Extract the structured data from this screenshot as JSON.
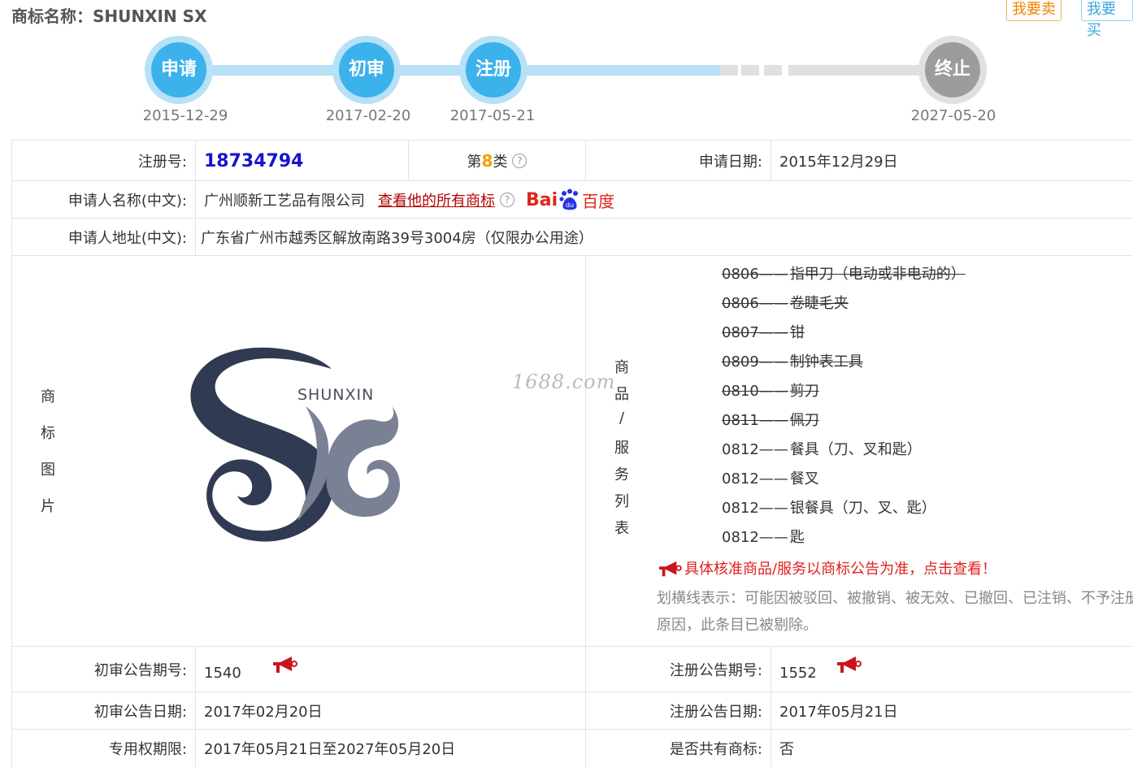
{
  "header": {
    "title": "商标名称：SHUNXIN SX",
    "btn_sell": "我要卖",
    "btn_buy": "我要买"
  },
  "timeline": [
    {
      "label": "申请",
      "date": "2015-12-29",
      "state": "done"
    },
    {
      "label": "初审",
      "date": "2017-02-20",
      "state": "done"
    },
    {
      "label": "注册",
      "date": "2017-05-21",
      "state": "done"
    },
    {
      "label": "终止",
      "date": "2027-05-20",
      "state": "future"
    }
  ],
  "info": {
    "reg_no_label": "注册号:",
    "reg_no": "18734794",
    "class_prefix": "第",
    "class_num": "8",
    "class_suffix": "类",
    "apply_date_label": "申请日期:",
    "apply_date": "2015年12月29日",
    "applicant_label": "申请人名称(中文):",
    "applicant": "广州顺新工艺品有限公司",
    "view_all_link": "查看他的所有商标",
    "baidu_bai": "Bai",
    "baidu_du": "du",
    "baidu_cn": "百度",
    "address_label": "申请人地址(中文):",
    "address": "广东省广州市越秀区解放南路39号3004房（仅限办公用途）",
    "image_label": [
      "商",
      "标",
      "图",
      "片"
    ],
    "logo_text": "SHUNXIN",
    "watermark": "1688.com",
    "goods_label": [
      "商",
      "品",
      "/",
      "服",
      "务",
      "列",
      "表"
    ],
    "goods": [
      {
        "code": "0806——",
        "name": "指甲刀（电动或非电动的）",
        "struck": true
      },
      {
        "code": "0806——",
        "name": "卷睫毛夹",
        "struck": true
      },
      {
        "code": "0807——",
        "name": "钳",
        "struck": true
      },
      {
        "code": "0809——",
        "name": "制钟表工具",
        "struck": true
      },
      {
        "code": "0810——",
        "name": "剪刀",
        "struck": true
      },
      {
        "code": "0811——",
        "name": "佩刀",
        "struck": true
      },
      {
        "code": "0812——",
        "name": "餐具（刀、叉和匙）",
        "struck": false
      },
      {
        "code": "0812——",
        "name": "餐叉",
        "struck": false
      },
      {
        "code": "0812——",
        "name": "银餐具（刀、叉、匙）",
        "struck": false
      },
      {
        "code": "0812——",
        "name": "匙",
        "struck": false
      }
    ],
    "notice": "具体核准商品/服务以商标公告为准，点击查看！",
    "explain_1": "划横线表示：可能因被驳回、被撤销、被无效、已撤回、已注销、不予注册",
    "explain_2": "原因，此条目已被剔除。",
    "prelim_no_label": "初审公告期号:",
    "prelim_no": "1540",
    "reg_pub_no_label": "注册公告期号:",
    "reg_pub_no": "1552",
    "prelim_date_label": "初审公告日期:",
    "prelim_date": "2017年02月20日",
    "reg_pub_date_label": "注册公告日期:",
    "reg_pub_date": "2017年05月21日",
    "exclusive_label": "专用权期限:",
    "exclusive": "2017年05月21日至2027年05月20日",
    "shared_label": "是否共有商标:",
    "shared": "否"
  }
}
